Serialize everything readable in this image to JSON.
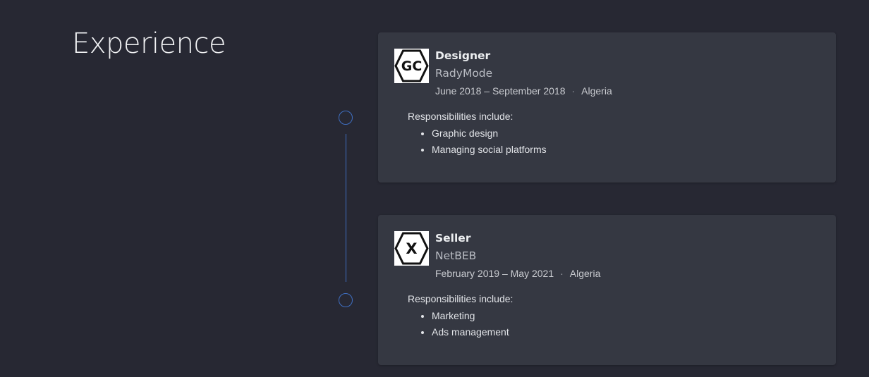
{
  "section": {
    "title": "Experience"
  },
  "colors": {
    "background": "#272833",
    "card": "#353842",
    "timeline": "#3f6fc2"
  },
  "experiences": [
    {
      "logo_icon": "gc-hexagon-logo",
      "logo_text": "GC",
      "title": "Designer",
      "company": "RadyMode",
      "dates": "June 2018 – September 2018",
      "separator": "·",
      "location": "Algeria",
      "responsibilities_intro": "Responsibilities include:",
      "responsibilities": [
        "Graphic design",
        "Managing social platforms"
      ]
    },
    {
      "logo_icon": "x-hexagon-logo",
      "logo_text": "X",
      "title": "Seller",
      "company": "NetBEB",
      "dates": "February 2019 – May 2021",
      "separator": "·",
      "location": "Algeria",
      "responsibilities_intro": "Responsibilities include:",
      "responsibilities": [
        "Marketing",
        "Ads management"
      ]
    }
  ]
}
